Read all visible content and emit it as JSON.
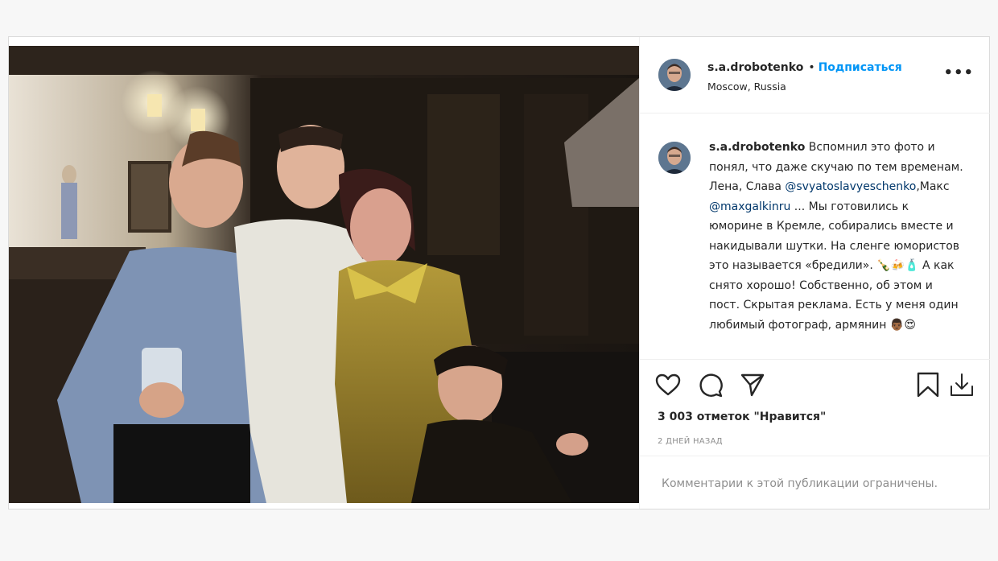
{
  "post": {
    "username": "s.a.drobotenko",
    "separator": "•",
    "follow_label": "Подписаться",
    "location": "Moscow, Russia",
    "more_label": "•••",
    "caption": {
      "username": "s.a.drobotenko",
      "text_1": "Вспомнил это фото и понял, что даже скучаю по тем временам. Лена, Слава ",
      "mention_1": "@svyatoslavyeschenko",
      "text_2": ",Макс ",
      "mention_2": "@maxgalkinru",
      "text_3": " ... Мы готовились к юморине в Кремле, собирались вместе и накидывали шутки. На сленге юмористов это называется «бредили». 🍾🍻🧴 А как снято хорошо! Собственно, об этом и пост. Скрытая реклама. Есть у меня один любимый фотограф, армянин 👨🏾😍"
    },
    "likes": "3 003 отметок \"Нравится\"",
    "date": "2 дней назад",
    "comments_limited": "Комментарии к этой публикации ограничены."
  },
  "icons": {
    "like": "heart-icon",
    "comment": "comment-icon",
    "share": "paper-plane-icon",
    "save": "bookmark-icon",
    "download": "download-icon"
  },
  "colors": {
    "follow": "#0095f6",
    "mention": "#00376b",
    "muted": "#8e8e8e",
    "border": "#dbdbdb"
  }
}
